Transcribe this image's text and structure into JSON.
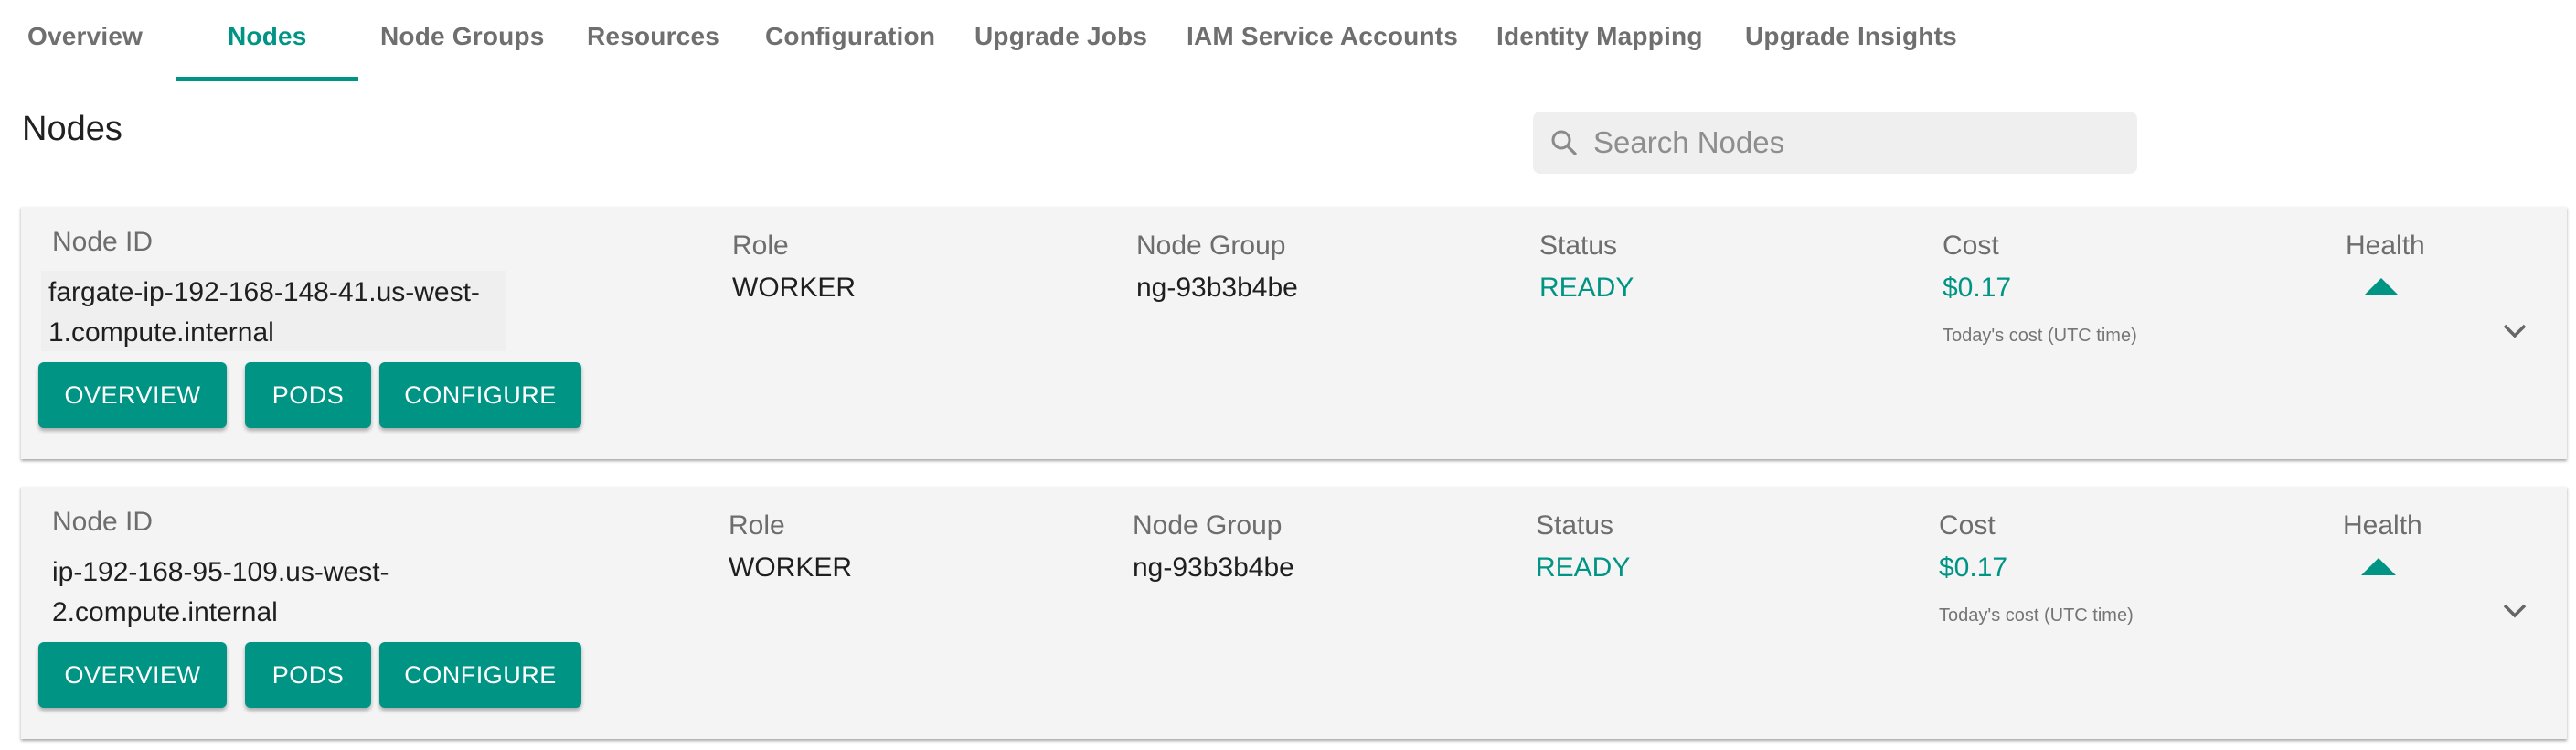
{
  "tabs": [
    {
      "label": "Overview",
      "active": false
    },
    {
      "label": "Nodes",
      "active": true
    },
    {
      "label": "Node Groups",
      "active": false
    },
    {
      "label": "Resources",
      "active": false
    },
    {
      "label": "Configuration",
      "active": false
    },
    {
      "label": "Upgrade Jobs",
      "active": false
    },
    {
      "label": "IAM Service Accounts",
      "active": false
    },
    {
      "label": "Identity Mapping",
      "active": false
    },
    {
      "label": "Upgrade Insights",
      "active": false
    }
  ],
  "page": {
    "title": "Nodes",
    "search": {
      "placeholder": "Search Nodes",
      "value": "",
      "icon": "search-icon"
    }
  },
  "columns": {
    "node_id": "Node ID",
    "role": "Role",
    "node_group": "Node Group",
    "status": "Status",
    "cost": "Cost",
    "health": "Health"
  },
  "nodes": [
    {
      "node_id_line1": "fargate-ip-192-168-148-41.us-west-",
      "node_id_line2": "1.compute.internal",
      "role": "WORKER",
      "node_group": "ng-93b3b4be",
      "status": "READY",
      "cost": "$0.17",
      "cost_caption": "Today's cost (UTC time)",
      "health_icon": "triangle-up-icon",
      "buttons": {
        "overview": "OVERVIEW",
        "pods": "PODS",
        "configure": "CONFIGURE"
      }
    },
    {
      "node_id_line1": "ip-192-168-95-109.us-west-",
      "node_id_line2": "2.compute.internal",
      "role": "WORKER",
      "node_group": "ng-93b3b4be",
      "status": "READY",
      "cost": "$0.17",
      "cost_caption": "Today's cost (UTC time)",
      "health_icon": "triangle-up-icon",
      "buttons": {
        "overview": "OVERVIEW",
        "pods": "PODS",
        "configure": "CONFIGURE"
      }
    }
  ],
  "colors": {
    "accent": "#009485",
    "tab_inactive": "#6f6f6f",
    "card_bg": "#f4f4f4"
  }
}
